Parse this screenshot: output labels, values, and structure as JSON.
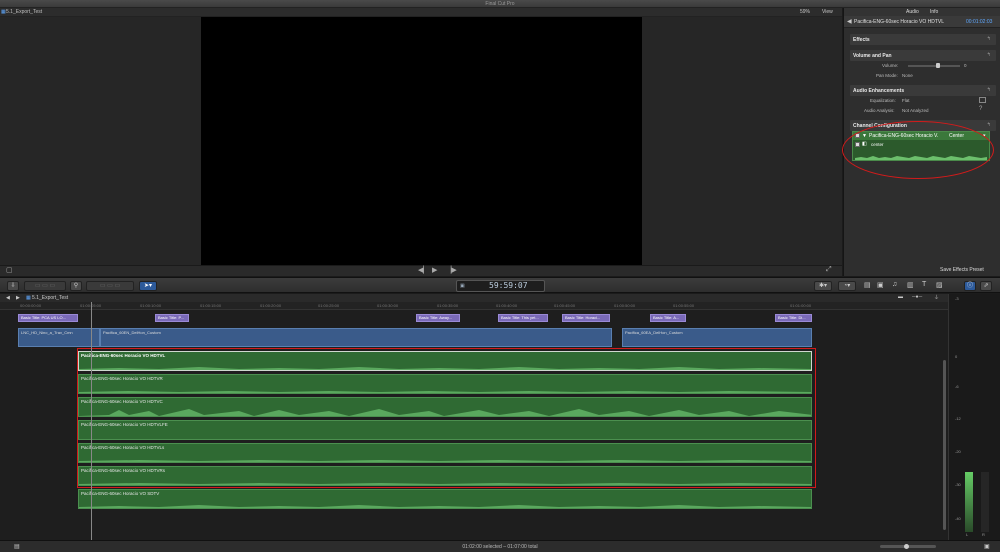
{
  "app": {
    "title": "Final Cut Pro"
  },
  "viewer": {
    "project_name": "5.1_Export_Test",
    "zoom": "59%",
    "view_menu": "View"
  },
  "inspector": {
    "tabs": [
      "Audio",
      "Info"
    ],
    "clip_name": "Pacifica-ENG-60sec Horacio VO HDTVL",
    "clip_timecode": "00:01:02:03",
    "effects_title": "Effects",
    "volume_pan_title": "Volume and Pan",
    "volume_label": "Volume:",
    "volume_value": "0",
    "pan_mode_label": "Pan Mode:",
    "pan_mode_value": "None",
    "audio_enh_title": "Audio Enhancements",
    "equalization_label": "Equalization:",
    "equalization_value": "Flat",
    "audio_analysis_label": "Audio Analysis:",
    "audio_analysis_value": "Not Analyzed",
    "channel_config_title": "Channel Configuration",
    "channel_clip_name": "Pacifica-ENG-60sec Horacio V.",
    "channel_mode": "Center",
    "channel_sub_label": "center",
    "save_preset": "Save Effects Preset"
  },
  "toolbar": {
    "timecode": "59:59:07"
  },
  "timeline": {
    "project_name": "5.1_Export_Test",
    "ruler_ticks": [
      "00:00:00:00",
      "01:00:05:00",
      "01:00:10:00",
      "01:00:15:00",
      "01:00:20:00",
      "01:00:25:00",
      "01:00:30:00",
      "01:00:35:00",
      "01:00:40:00",
      "01:00:45:00",
      "01:00:50:00",
      "01:00:55:00",
      "01:01:00:00"
    ],
    "title_clips": [
      "Basic Title: PCA US LO...",
      "Basic Title: P...",
      "Basic Title: Away...",
      "Basic Title: This yet...",
      "Basic Title: Horaci...",
      "Basic Title: A...",
      "Basic Title: Di..."
    ],
    "video_clips": [
      "LNC_HD_Nino_a_Trav_Cmn",
      "Pacifica_60EN_DelHon_Custom",
      "Pacifica_60EA_DelHon_Custom"
    ],
    "audio_clips": [
      "Pacifica-ENG-60sec Horacio VO HDTVL",
      "Pacifica-ENG-60sec Horacio VO HDTVR",
      "Pacifica-ENG-60sec Horacio VO HDTVC",
      "Pacifica-ENG-60sec Horacio VO HDTVLFE",
      "Pacifica-ENG-60sec Horacio VO HDTVLs",
      "Pacifica-ENG-60sec Horacio VO HDTVRs",
      "Pacifica-ENG-60sec Horacio VO SDTV"
    ]
  },
  "meters": {
    "labels": [
      "-3",
      "0",
      "-6",
      "-12",
      "-20",
      "-30",
      "-40"
    ],
    "channels": [
      "L",
      "R"
    ]
  },
  "status": {
    "text": "01:02:00 selected – 01:07:00 total"
  }
}
